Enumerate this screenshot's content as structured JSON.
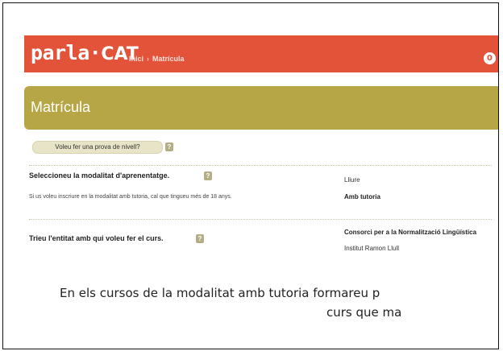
{
  "header": {
    "logo_word": "parla",
    "logo_dot": "·",
    "logo_cat": "CAT",
    "breadcrumb_home": "Inici",
    "breadcrumb_sep": "›",
    "breadcrumb_current": "Matrícula",
    "badge_value": "0"
  },
  "page": {
    "title": "Matrícula",
    "level_test_button": "Voleu fer una prova de nivell?",
    "help_glyph": "?"
  },
  "modality": {
    "label": "Seleccioneu la modalitat d'aprenentatge.",
    "note": "Si us voleu inscriure en la modalitat amb tutoria, cal que tingueu més de 18 anys.",
    "options": [
      "Lliure",
      "Amb tutoria"
    ]
  },
  "entity": {
    "label": "Trieu l'entitat amb qui voleu fer el curs.",
    "options": [
      "Consorci per a la Normalització Lingüística",
      "Institut Ramon Llull"
    ]
  },
  "caption": {
    "line1": "En els cursos de la modalitat amb tutoria formareu p",
    "line2": "curs que ma"
  },
  "colors": {
    "header_bg": "#e2533a",
    "title_bg": "#b6a645",
    "button_bg": "#e8e4c7"
  }
}
